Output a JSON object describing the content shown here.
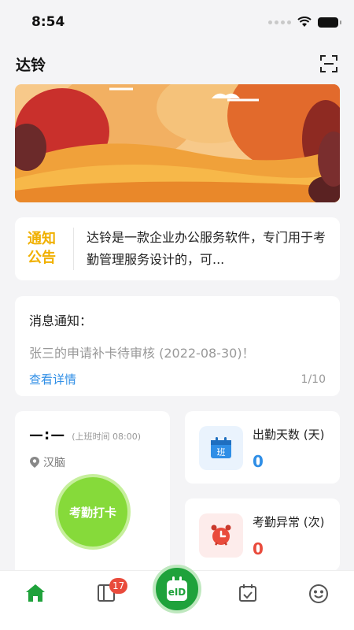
{
  "status_bar": {
    "time": "8:54"
  },
  "header": {
    "title": "达铃"
  },
  "notice": {
    "tag_line1": "通知",
    "tag_line2": "公告",
    "text": "达铃是一款企业办公服务软件，专门用于考勤管理服务设计的，可..."
  },
  "messages": {
    "title": "消息通知：",
    "content": "张三的申请补卡待审核 (2022-08-30)！",
    "link": "查看详情",
    "pager": "1/10"
  },
  "punch": {
    "time": "—:—",
    "work_start_hint": "(上班时间 08:00)",
    "location": "汉脑",
    "button_label": "考勤打卡"
  },
  "stats": {
    "attendance_days": {
      "label": "出勤天数 (天)",
      "value": "0",
      "color": "#2f8ee6",
      "icon_text": "班"
    },
    "abnormal": {
      "label": "考勤异常 (次)",
      "value": "0",
      "color": "#e94b3c"
    }
  },
  "tab_bar": {
    "badge_count": "17",
    "center_icon_text": "eID"
  },
  "colors": {
    "brand_green": "#1fa23b",
    "punch_green": "#86da3a",
    "notice_yellow": "#f0b000",
    "link_blue": "#2f8ee6",
    "alert_red": "#e94b3c"
  },
  "icons": [
    "wifi-icon",
    "battery-icon",
    "scan-icon",
    "location-pin-icon",
    "calendar-icon",
    "alarm-clock-icon",
    "home-icon",
    "panel-icon",
    "eid-icon",
    "calendar-check-icon",
    "smiley-icon"
  ]
}
